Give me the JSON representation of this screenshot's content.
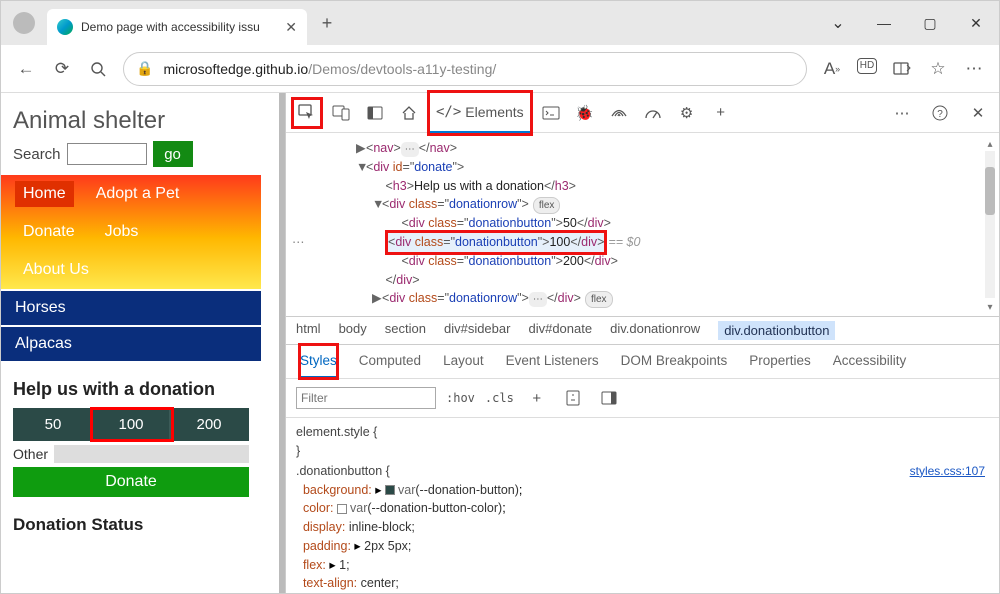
{
  "window": {
    "tab_title": "Demo page with accessibility issu",
    "url_prefix": "microsoftedge.github.io",
    "url_path": "/Demos/devtools-a11y-testing/"
  },
  "page": {
    "title": "Animal shelter",
    "search_label": "Search",
    "go_label": "go",
    "nav": {
      "home": "Home",
      "adopt": "Adopt a Pet",
      "donate": "Donate",
      "jobs": "Jobs",
      "about": "About Us"
    },
    "categories": [
      "Horses",
      "Alpacas"
    ],
    "donate_heading": "Help us with a donation",
    "amounts": [
      "50",
      "100",
      "200"
    ],
    "selected_amount_index": 1,
    "other_label": "Other",
    "donate_button": "Donate",
    "status_heading": "Donation Status"
  },
  "devtools": {
    "elements_label": "Elements",
    "dom": {
      "nav_tag": "nav",
      "donate_id": "donate",
      "h3_text": "Help us with a donation",
      "row_class": "donationrow",
      "btn_class": "donationbutton",
      "flex_pill": "flex",
      "b50": "50",
      "b100": "100",
      "b200": "200",
      "eq": "== $0"
    },
    "crumbs": [
      "html",
      "body",
      "section",
      "div#sidebar",
      "div#donate",
      "div.donationrow",
      "div.donationbutton"
    ],
    "pane_tabs": [
      "Styles",
      "Computed",
      "Layout",
      "Event Listeners",
      "DOM Breakpoints",
      "Properties",
      "Accessibility"
    ],
    "filter_placeholder": "Filter",
    "hov": ":hov",
    "cls": ".cls",
    "element_style": "element.style {",
    "close_brace": "}",
    "rule_selector": ".donationbutton {",
    "src": "styles.css:107",
    "props": {
      "background_k": "background:",
      "background_v": "var(--donation-button);",
      "color_k": "color:",
      "color_v": "var(--donation-button-color);",
      "display_k": "display:",
      "display_v": "inline-block;",
      "padding_k": "padding:",
      "padding_v": "2px 5px;",
      "flex_k": "flex:",
      "flex_v": "1;",
      "ta_k": "text-align:",
      "ta_v": "center;"
    }
  },
  "chart_data": {
    "type": "bar",
    "note": "no chart present"
  }
}
